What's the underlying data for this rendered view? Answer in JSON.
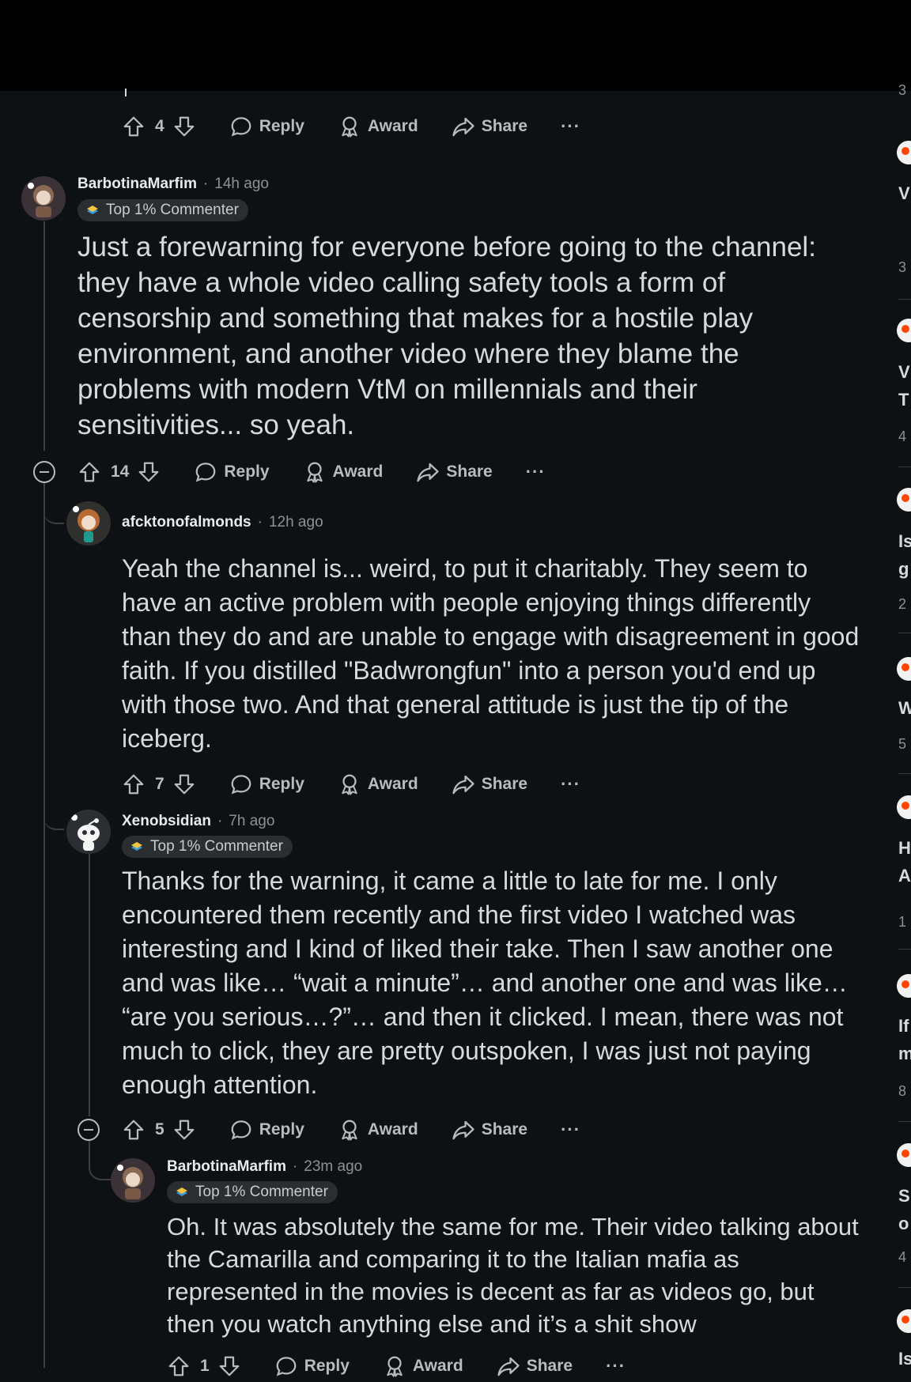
{
  "common": {
    "reply": "Reply",
    "award": "Award",
    "share": "Share",
    "more": "···"
  },
  "top_actions": {
    "votes": "4"
  },
  "comments": [
    {
      "user": "BarbotinaMarfim",
      "time": "14h ago",
      "badge": "Top 1% Commenter",
      "body": "Just a forewarning for everyone before going to the channel: they have a whole video calling safety tools a form of censorship and something that makes for a hostile play environment, and another video where they blame the problems with modern VtM on millennials and their sensitivities... so yeah.",
      "votes": "14"
    },
    {
      "user": "afcktonofalmonds",
      "time": "12h ago",
      "body": "Yeah the channel is... weird, to put it charitably. They seem to have an active problem with people enjoying things differently than they do and are unable to engage with disagreement in good faith. If you distilled \"Badwrongfun\" into a person you'd end up with those two. And that general attitude is just the tip of the iceberg.",
      "votes": "7"
    },
    {
      "user": "Xenobsidian",
      "time": "7h ago",
      "badge": "Top 1% Commenter",
      "body": "Thanks for the warning, it came a little to late for me. I only encountered them recently and the first video I watched was interesting and I kind of liked their take. Then I saw another one and was like… “wait a minute”… and another one and was like… “are you serious…?”… and then it clicked. I mean, there was not much to click, they are pretty outspoken, I was just not paying enough attention.",
      "votes": "5"
    },
    {
      "user": "BarbotinaMarfim",
      "time": "23m ago",
      "badge": "Top 1% Commenter",
      "body": "Oh. It was absolutely the same for me. Their video talking about the Camarilla and comparing it to the Italian mafia as represented in the movies is decent as far as videos go, but then you watch anything else and it’s a shit show",
      "votes": "1"
    }
  ],
  "sidebar_fragments": [
    "3",
    "V",
    "3",
    "V",
    "T",
    "4",
    "Is",
    "g",
    "2",
    "W",
    "5",
    "H",
    "A",
    "1",
    "If",
    "m",
    "8",
    "S",
    "o",
    "4",
    "Is"
  ]
}
